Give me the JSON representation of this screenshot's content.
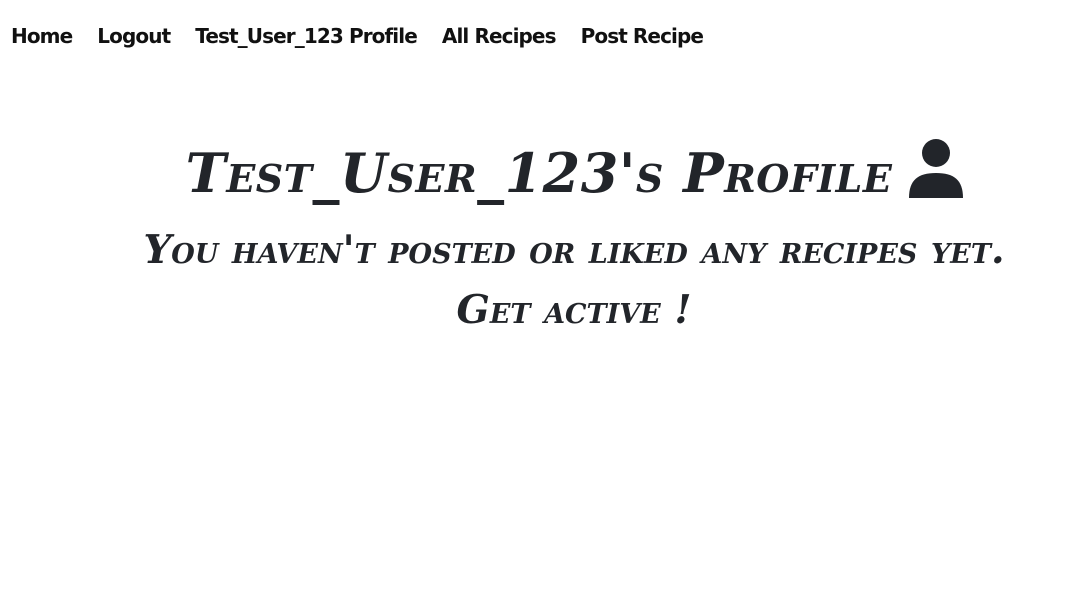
{
  "nav": {
    "items": [
      {
        "label": "Home"
      },
      {
        "label": "Logout"
      },
      {
        "label": "Test_User_123 Profile"
      },
      {
        "label": "All Recipes"
      },
      {
        "label": "Post Recipe"
      }
    ]
  },
  "profile": {
    "title": "Test_User_123's Profile",
    "icon": "user-icon",
    "empty_line_1": "You haven't posted or liked any recipes yet.",
    "empty_line_2": "Get active !"
  },
  "colors": {
    "text": "#22252a",
    "nav_text": "#111111",
    "background": "#ffffff"
  }
}
